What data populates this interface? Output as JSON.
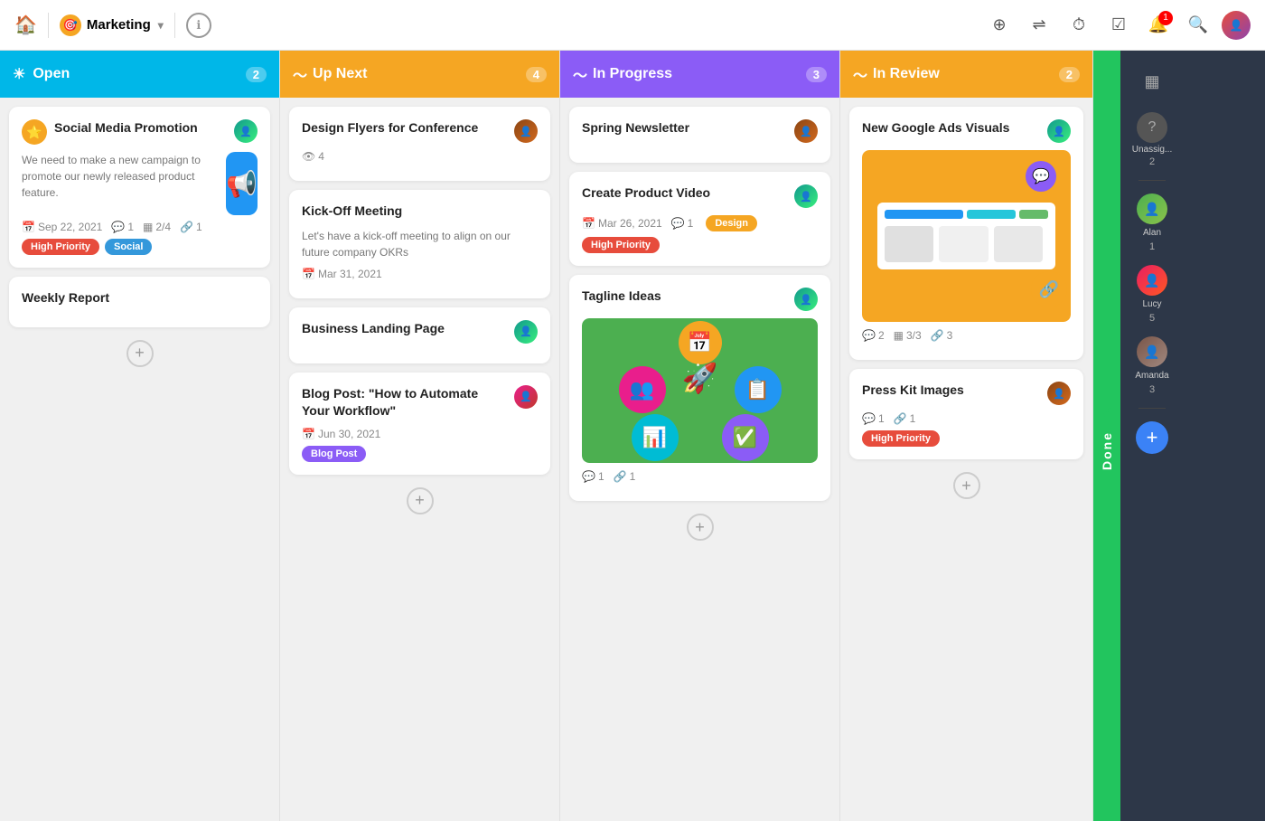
{
  "app": {
    "workspace": "Marketing",
    "nav_icons": [
      "⊕",
      "⇄",
      "⏱",
      "✓"
    ],
    "notification_count": "1"
  },
  "columns": [
    {
      "id": "open",
      "title": "Open",
      "count": "2",
      "color": "col-open",
      "cards": [
        {
          "id": "social-media",
          "title": "Social Media Promotion",
          "desc": "We need to make a new campaign to promote our newly released product feature.",
          "date": "Sep 22, 2021",
          "comments": "1",
          "tasks": "2/4",
          "attachments": "1",
          "tags": [
            "High Priority",
            "Social"
          ],
          "has_image": true,
          "avatar_class": "avatar-teal"
        },
        {
          "id": "weekly-report",
          "title": "Weekly Report",
          "tags": [],
          "avatar_class": ""
        }
      ]
    },
    {
      "id": "upnext",
      "title": "Up Next",
      "count": "4",
      "color": "col-upnext",
      "cards": [
        {
          "id": "design-flyers",
          "title": "Design Flyers for Conference",
          "watch_count": "4",
          "avatar_class": "avatar-brown"
        },
        {
          "id": "kickoff",
          "title": "Kick-Off Meeting",
          "desc": "Let's have a kick-off meeting to align on our future company OKRs",
          "date": "Mar 31, 2021",
          "avatar_class": ""
        },
        {
          "id": "business-landing",
          "title": "Business Landing Page",
          "avatar_class": "avatar-teal"
        },
        {
          "id": "blog-post",
          "title": "Blog Post: \"How to Automate Your Workflow\"",
          "date": "Jun 30, 2021",
          "tags": [
            "Blog Post"
          ],
          "avatar_class": "avatar-pink"
        }
      ]
    },
    {
      "id": "inprogress",
      "title": "In Progress",
      "count": "3",
      "color": "col-inprogress",
      "cards": [
        {
          "id": "spring-newsletter",
          "title": "Spring Newsletter",
          "avatar_class": "avatar-brown"
        },
        {
          "id": "create-product-video",
          "title": "Create Product Video",
          "date": "Mar 26, 2021",
          "comments": "1",
          "tags": [
            "Design",
            "High Priority"
          ],
          "avatar_class": "avatar-teal"
        },
        {
          "id": "tagline-ideas",
          "title": "Tagline Ideas",
          "comments": "1",
          "attachments": "1",
          "avatar_class": "avatar-teal"
        }
      ]
    },
    {
      "id": "inreview",
      "title": "In Review",
      "count": "2",
      "color": "col-inreview",
      "cards": [
        {
          "id": "google-ads",
          "title": "New Google Ads Visuals",
          "comments": "2",
          "tasks": "3/3",
          "attachments": "3",
          "avatar_class": "avatar-teal"
        },
        {
          "id": "press-kit",
          "title": "Press Kit Images",
          "comments": "1",
          "attachments": "1",
          "tags": [
            "High Priority"
          ],
          "avatar_class": "avatar-brown"
        }
      ]
    }
  ],
  "done": {
    "label": "Done",
    "check_icon": "✓"
  },
  "sidebar_users": {
    "unassigned": {
      "label": "Unassig...",
      "count": "2"
    },
    "alan": {
      "name": "Alan",
      "count": "1"
    },
    "lucy": {
      "name": "Lucy",
      "count": "5"
    },
    "amanda": {
      "name": "Amanda",
      "count": "3"
    }
  },
  "labels": {
    "high_priority": "High Priority",
    "social": "Social",
    "design": "Design",
    "blog_post": "Blog Post",
    "add": "+"
  }
}
